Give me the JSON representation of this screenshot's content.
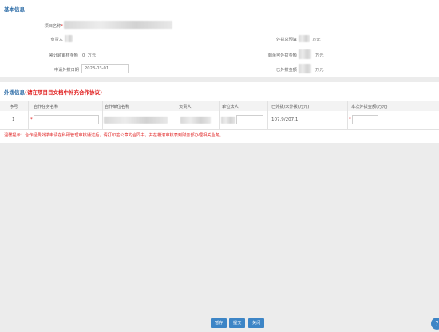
{
  "basic_section": {
    "title": "基本信息"
  },
  "basic": {
    "project_name_label": "项目名称",
    "required_mark": "*",
    "leader_label": "负责人",
    "cumulative_label": "累计跨审核金额",
    "cumulative_value": "0",
    "cumulative_unit": "万元",
    "apply_date_label": "申请外拨日期",
    "apply_date_value": "2023-03-01",
    "total_budget_label": "外拨总预算",
    "total_budget_unit": "万元",
    "remaining_label": "剩余可外拨金额",
    "remaining_unit": "万元",
    "paid_label": "已外拨金额",
    "paid_unit": "万元"
  },
  "transfer_section": {
    "title": "外拨信息",
    "note": "(请在项目目文档中补充合作协议)"
  },
  "table": {
    "headers": [
      "序号",
      "合作任务名称",
      "合作单位名称",
      "负责人",
      "单位法人",
      "已外拨/未外拨(万元)",
      "本次外拨金额(万元)"
    ],
    "rows": [
      {
        "index": "1",
        "transferred": "107.9/207.1"
      }
    ]
  },
  "warning": "温馨提示：合作经费外拨申请在科研管理审核通过后，请打印签公章的合同书，并在横滚审核表到财务部办理相关业务。",
  "buttons": {
    "save": "暂存",
    "submit": "提交",
    "close": "关闭"
  },
  "icons": {
    "help": "help-icon"
  }
}
